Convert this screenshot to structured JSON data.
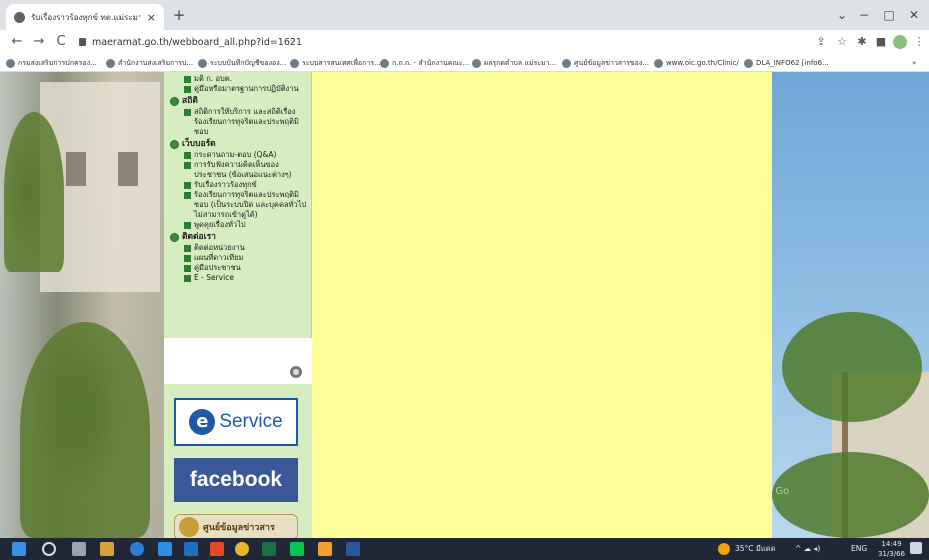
{
  "browser": {
    "tab_title": "รับเรื่องราวร้องทุกข์ ทต.แม่ระมาด อ.แม่",
    "tab_close": "×",
    "new_tab": "+",
    "url": "maeramat.go.th/webboard_all.php?id=1621",
    "window_controls": {
      "dropdown": "⌄",
      "minimize": "−",
      "maximize": "□",
      "close": "✕"
    },
    "nav": {
      "back": "←",
      "forward": "→",
      "reload": "C"
    },
    "bookmarks": [
      "กรมส่งเสริมการปกครอง...",
      "สำนักงานส่งเสริมการป...",
      "ระบบบันทึกบัญชีขององ...",
      "ระบบสารสนเทศเพื่อการ...",
      "ก.ถ.ถ. - สำนักงานคณะ...",
      "ผลรุกดตำบล แม่ระมา...",
      "ศูนย์ข้อมูลข่าวสารของ...",
      "www.oic.go.th/Clinic/",
      "DLA_INFO62 [info6..."
    ],
    "bookmarks_more": "»"
  },
  "sidebar": {
    "partial_top_items": [
      "มติ ก. อบต.",
      "คู่มือหรือมาตรฐานการปฏิบัติงาน"
    ],
    "sections": [
      {
        "title": "สถิติ",
        "items": [
          "สถิติการให้บริการ และสถิติเรื่องร้องเรียนการทุจริตและประพฤติมิชอบ"
        ]
      },
      {
        "title": "เว็บบอร์ด",
        "items": [
          "กระดานถาม-ตอบ (Q&A)",
          "การรับฟังความคิดเห็นของประชาชน (ข้อเสนอแนะต่างๆ)",
          "รับเรื่องราวร้องทุกข์",
          "ร้องเรียนการทุจริตและประพฤติมิชอบ (เป็นระบบปิด และบุคคลทั่วไปไม่สามารถเข้าดูได้)",
          "พูดคุยเรื่องทั่วไป"
        ]
      },
      {
        "title": "ติดต่อเรา",
        "items": [
          "ติดต่อหน่วยงาน",
          "แผนที่ดาวเทียม",
          "คู่มือประชาชน",
          "E - Service"
        ]
      }
    ]
  },
  "banners": {
    "eservice_letter": "e",
    "eservice_label": "Service",
    "facebook_label": "facebook",
    "info_label": "ศูนย์ข้อมูลข่าวสาร"
  },
  "watermark": "Ac Go",
  "taskbar": {
    "weather": "35°C มีแดด",
    "language": "ENG",
    "time": "14:49",
    "date": "31/3/66"
  },
  "colors": {
    "sidebar_bg": "#d6eebf",
    "content_bg": "#ffff99",
    "facebook_blue": "#3b5998",
    "eservice_blue": "#1f5aa6"
  }
}
